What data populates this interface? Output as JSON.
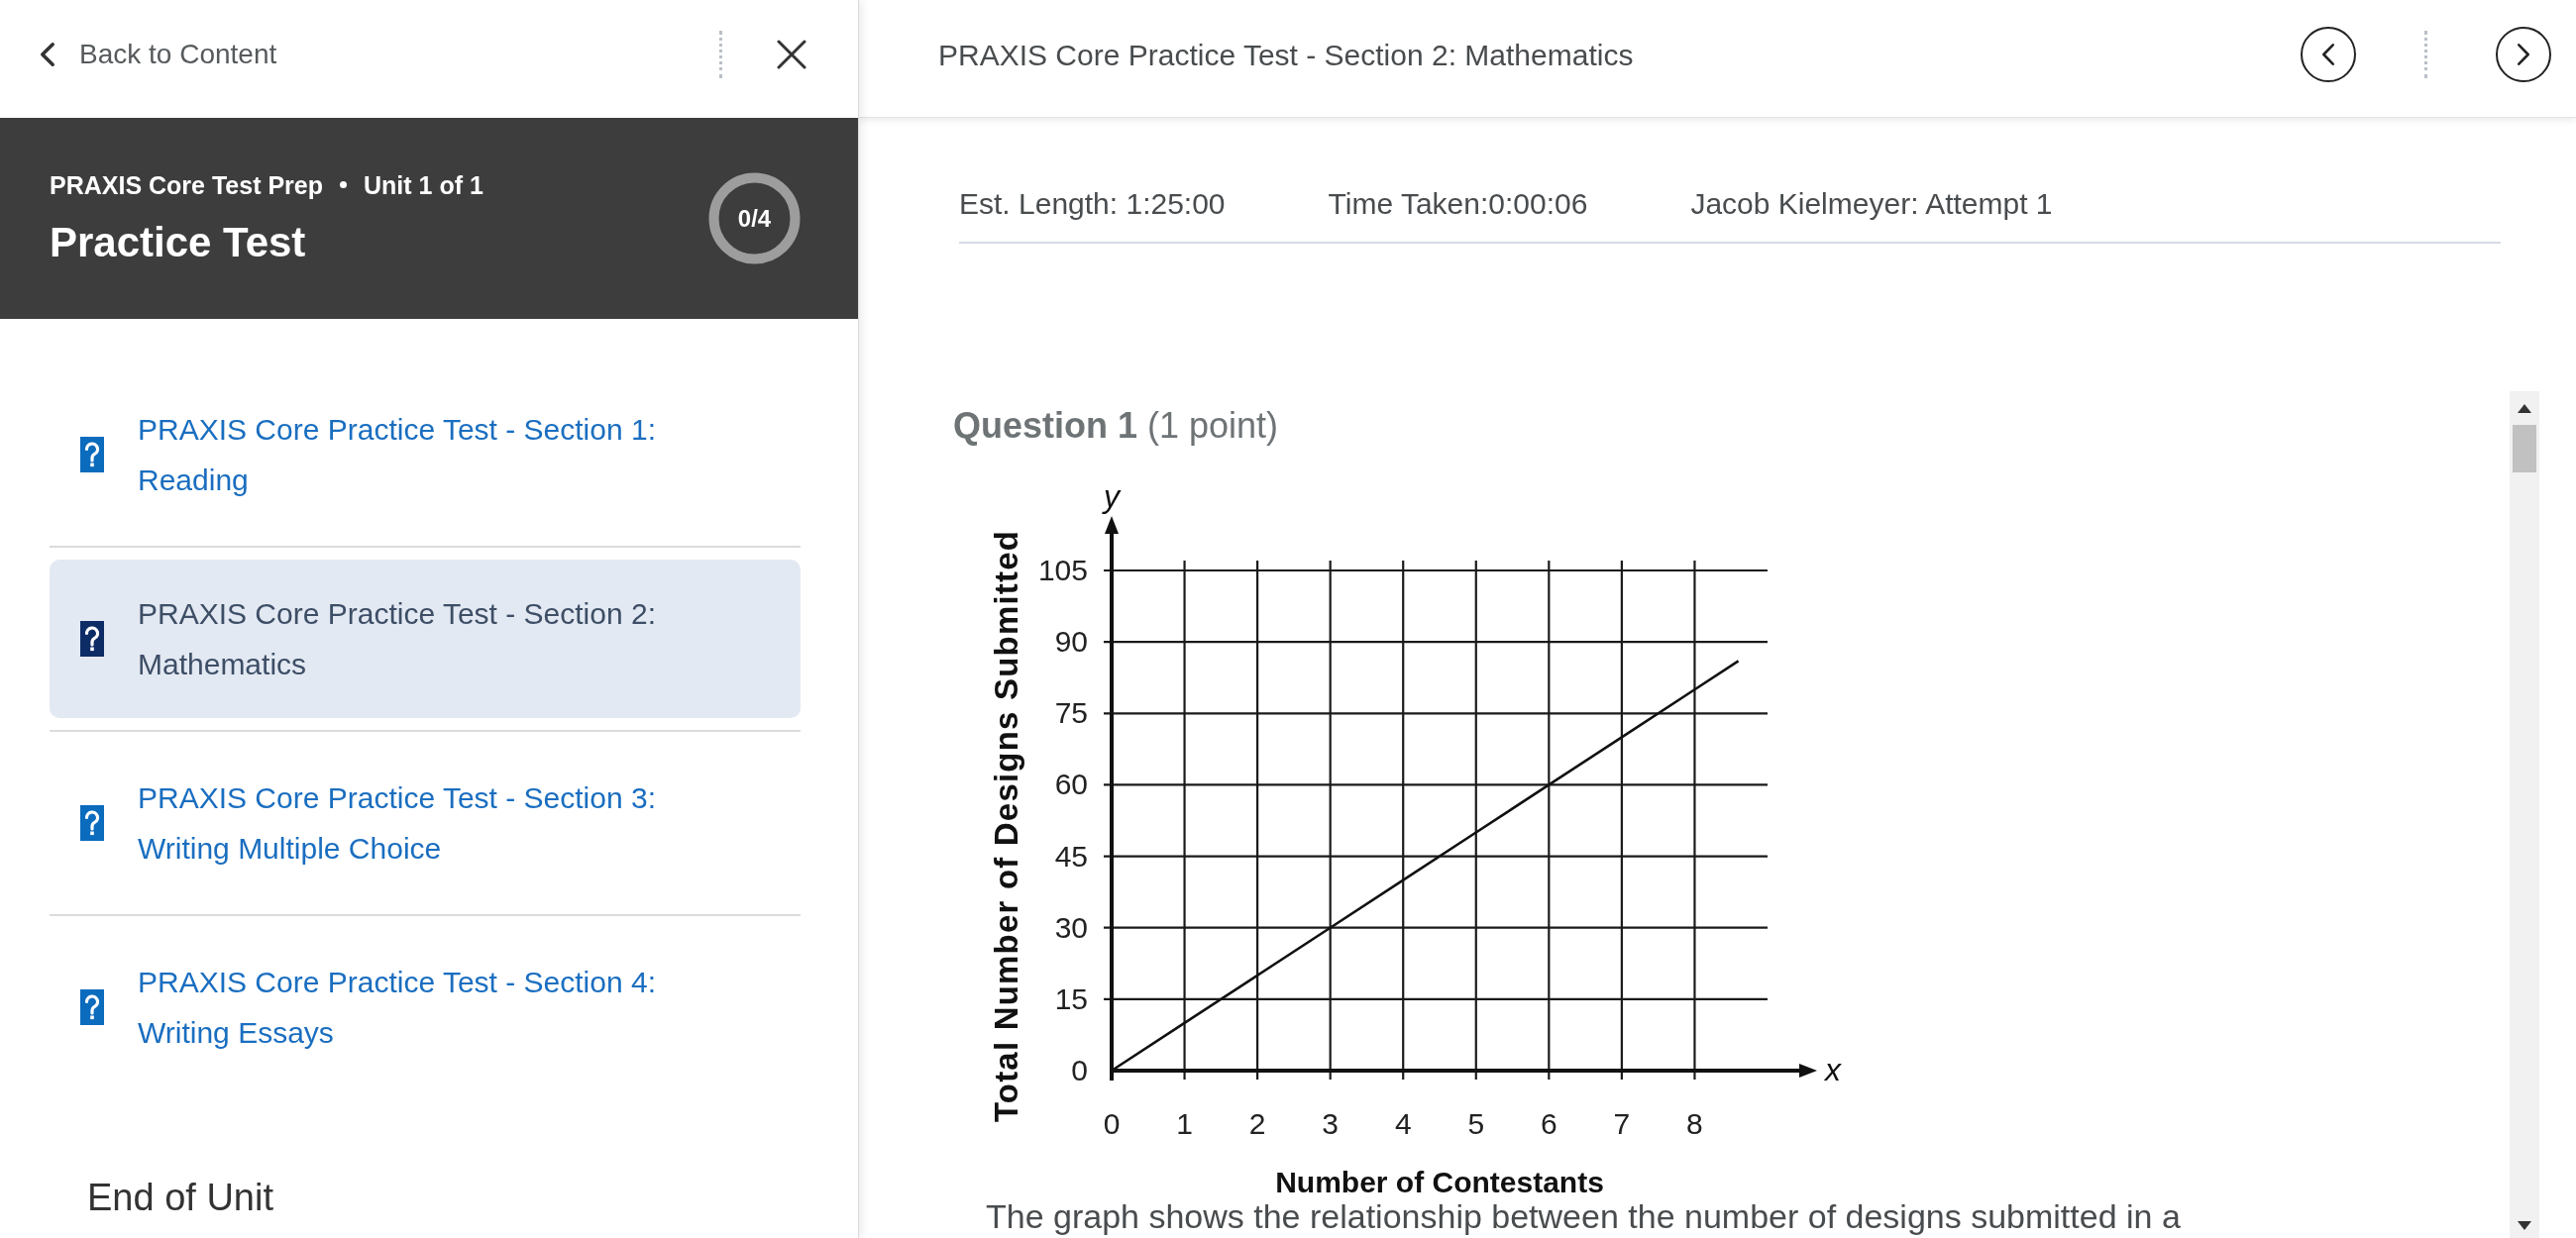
{
  "sidebar": {
    "back_link": "Back to Content",
    "header": {
      "course": "PRAXIS Core Test Prep",
      "unit": "Unit 1 of 1",
      "title": "Practice Test",
      "progress": "0/4",
      "level": 0
    },
    "items": [
      {
        "title": "PRAXIS Core Practice Test - Section 1: Reading",
        "selected": false
      },
      {
        "title": "PRAXIS Core Practice Test - Section 2: Mathematics",
        "selected": true
      },
      {
        "title": "PRAXIS Core Practice Test - Section 3: Writing Multiple Choice",
        "selected": false
      },
      {
        "title": "PRAXIS Core Practice Test - Section 4: Writing Essays",
        "selected": false
      }
    ],
    "end_of_unit": "End of Unit"
  },
  "topbar": {
    "title": "PRAXIS Core Practice Test - Section 2: Mathematics"
  },
  "info": [
    "Est. Length: 1:25:00",
    "Time Taken:0:00:06",
    "Jacob Kielmeyer: Attempt 1"
  ],
  "question": {
    "heading": "**Question 1** (1 point)",
    "chart_data": {
      "type": "line",
      "xlabel": "Number of Contestants",
      "ylabel": "Total Number of Designs Submitted",
      "x": [
        0,
        1,
        2,
        3,
        4,
        5,
        6,
        7,
        8,
        8.6
      ],
      "series": [
        {
          "color": "#111111",
          "values": [
            0,
            10,
            20,
            30,
            40,
            50,
            60,
            70,
            80,
            86
          ]
        }
      ],
      "xlim": [
        0,
        9
      ],
      "ylim": [
        0,
        105
      ],
      "xticks": [
        0,
        1,
        2,
        3,
        4,
        5,
        6,
        7,
        8
      ],
      "yticks": [
        0,
        15,
        30,
        45,
        60,
        75,
        90,
        105
      ],
      "grid": true,
      "annotations": [
        "x",
        "y"
      ]
    },
    "text": "The graph shows the relationship between the number of designs submitted in a"
  }
}
